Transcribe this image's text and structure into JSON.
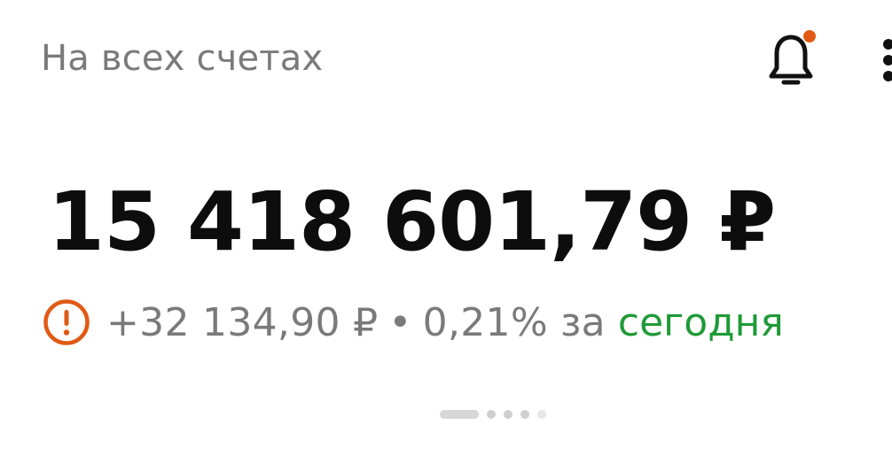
{
  "header": {
    "title": "На всех счетах",
    "notification_icon": "bell-icon",
    "notification_badge_color": "#e05a16",
    "more_icon": "more-vertical-icon"
  },
  "balance": {
    "total": "15 418 601,79 ₽"
  },
  "change": {
    "status_icon": "warning-icon",
    "status_color": "#e05a16",
    "amount": "+32 134,90 ₽",
    "separator": "•",
    "percent": "0,21%",
    "period_prefix": "за",
    "period_link": "сегодня",
    "period_link_color": "#1f9a37"
  },
  "pager": {
    "pages": 5,
    "current": 1
  }
}
